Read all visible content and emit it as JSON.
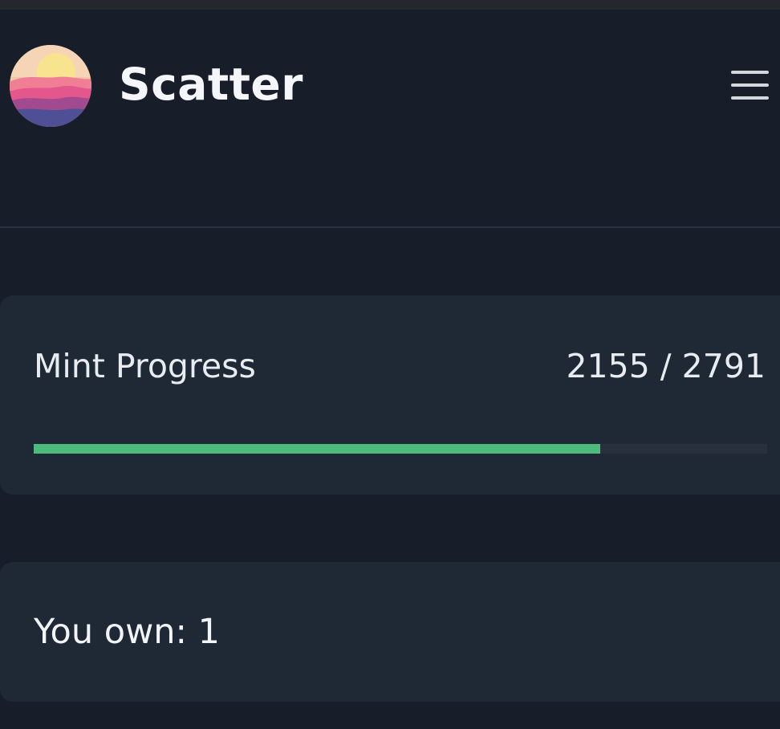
{
  "app": {
    "title": "Scatter",
    "logo_icon": "sunset-logo-icon",
    "menu_icon": "hamburger-menu-icon"
  },
  "mint": {
    "label": "Mint Progress",
    "minted": 2155,
    "total": 2791,
    "count_text": "2155 / 2791",
    "progress_fraction": 0.772
  },
  "ownership": {
    "text": "You own: 1"
  },
  "colors": {
    "background": "#181e29",
    "card": "#1f2835",
    "progress_fill": "#4dbb7e",
    "progress_track": "#27303c",
    "text": "#f1f3f6"
  }
}
